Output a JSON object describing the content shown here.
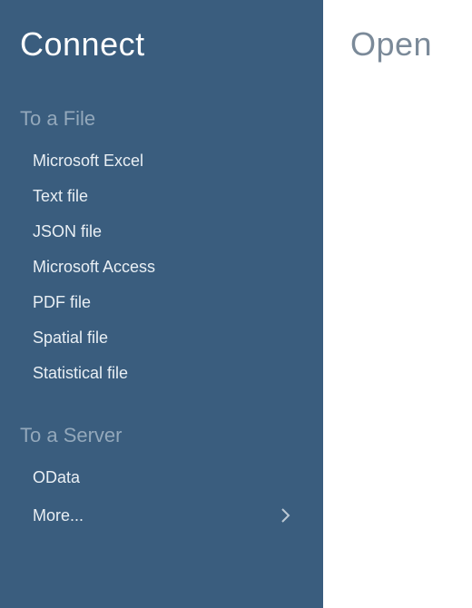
{
  "connect": {
    "title": "Connect",
    "sections": {
      "file": {
        "header": "To a File",
        "items": [
          {
            "label": "Microsoft Excel"
          },
          {
            "label": "Text file"
          },
          {
            "label": "JSON file"
          },
          {
            "label": "Microsoft Access"
          },
          {
            "label": "PDF file"
          },
          {
            "label": "Spatial file"
          },
          {
            "label": "Statistical file"
          }
        ]
      },
      "server": {
        "header": "To a Server",
        "items": [
          {
            "label": "OData"
          },
          {
            "label": "More...",
            "chevron": true
          }
        ]
      }
    }
  },
  "open": {
    "title": "Open"
  }
}
